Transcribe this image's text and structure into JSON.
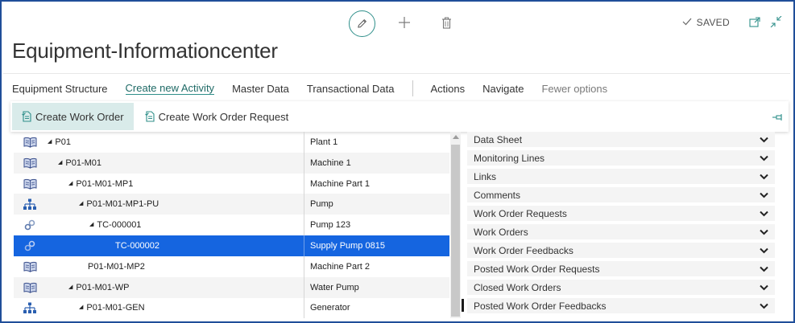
{
  "header": {
    "edit_icon": "pencil-icon",
    "new_icon": "plus-icon",
    "delete_icon": "trash-icon",
    "saved_label": "SAVED",
    "open_new_window_icon": "open-in-new-window-icon",
    "collapse_icon": "collapse-icon"
  },
  "page": {
    "title": "Equipment-Informationcenter"
  },
  "actions": [
    {
      "label": "Equipment Structure"
    },
    {
      "label": "Create new Activity",
      "active": true
    },
    {
      "label": "Master Data"
    },
    {
      "label": "Transactional Data"
    },
    {
      "label": "Actions"
    },
    {
      "label": "Navigate"
    },
    {
      "label": "Fewer options",
      "muted": true
    }
  ],
  "ribbon": {
    "create_work_order": "Create Work Order",
    "create_work_order_request": "Create Work Order Request"
  },
  "tree_rows": [
    {
      "icon": "book-icon",
      "indent": 0,
      "expanded": true,
      "name": "P01",
      "description": "Plant 1"
    },
    {
      "icon": "book-icon",
      "indent": 1,
      "expanded": true,
      "name": "P01-M01",
      "description": "Machine 1"
    },
    {
      "icon": "book-icon",
      "indent": 2,
      "expanded": true,
      "name": "P01-M01-MP1",
      "description": "Machine Part 1"
    },
    {
      "icon": "hierarchy-icon",
      "indent": 3,
      "expanded": true,
      "name": "P01-M01-MP1-PU",
      "description": "Pump"
    },
    {
      "icon": "link-icon",
      "indent": 4,
      "expanded": true,
      "name": "TC-000001",
      "description": "Pump 123"
    },
    {
      "icon": "link-icon",
      "indent": 5,
      "expanded": false,
      "name": "TC-000002",
      "description": "Supply Pump 0815",
      "selected": true
    },
    {
      "icon": "book-icon",
      "indent": 3,
      "expanded": false,
      "name": "P01-M01-MP2",
      "description": "Machine Part 2"
    },
    {
      "icon": "book-icon",
      "indent": 2,
      "expanded": true,
      "name": "P01-M01-WP",
      "description": "Water Pump"
    },
    {
      "icon": "hierarchy-icon",
      "indent": 3,
      "expanded": true,
      "name": "P01-M01-GEN",
      "description": "Generator"
    }
  ],
  "factbox": [
    "Data Sheet",
    "Monitoring Lines",
    "Links",
    "Comments",
    "Work Order Requests",
    "Work Orders",
    "Work Order Feedbacks",
    "Posted Work Order Requests",
    "Closed Work Orders",
    "Posted Work Order Feedbacks"
  ],
  "colors": {
    "accent": "#2f8f8a",
    "selection": "#1565e0",
    "frame": "#1f4e99",
    "book_icon": "#3a4f8c",
    "hierarchy_icon": "#2a5fb0"
  }
}
